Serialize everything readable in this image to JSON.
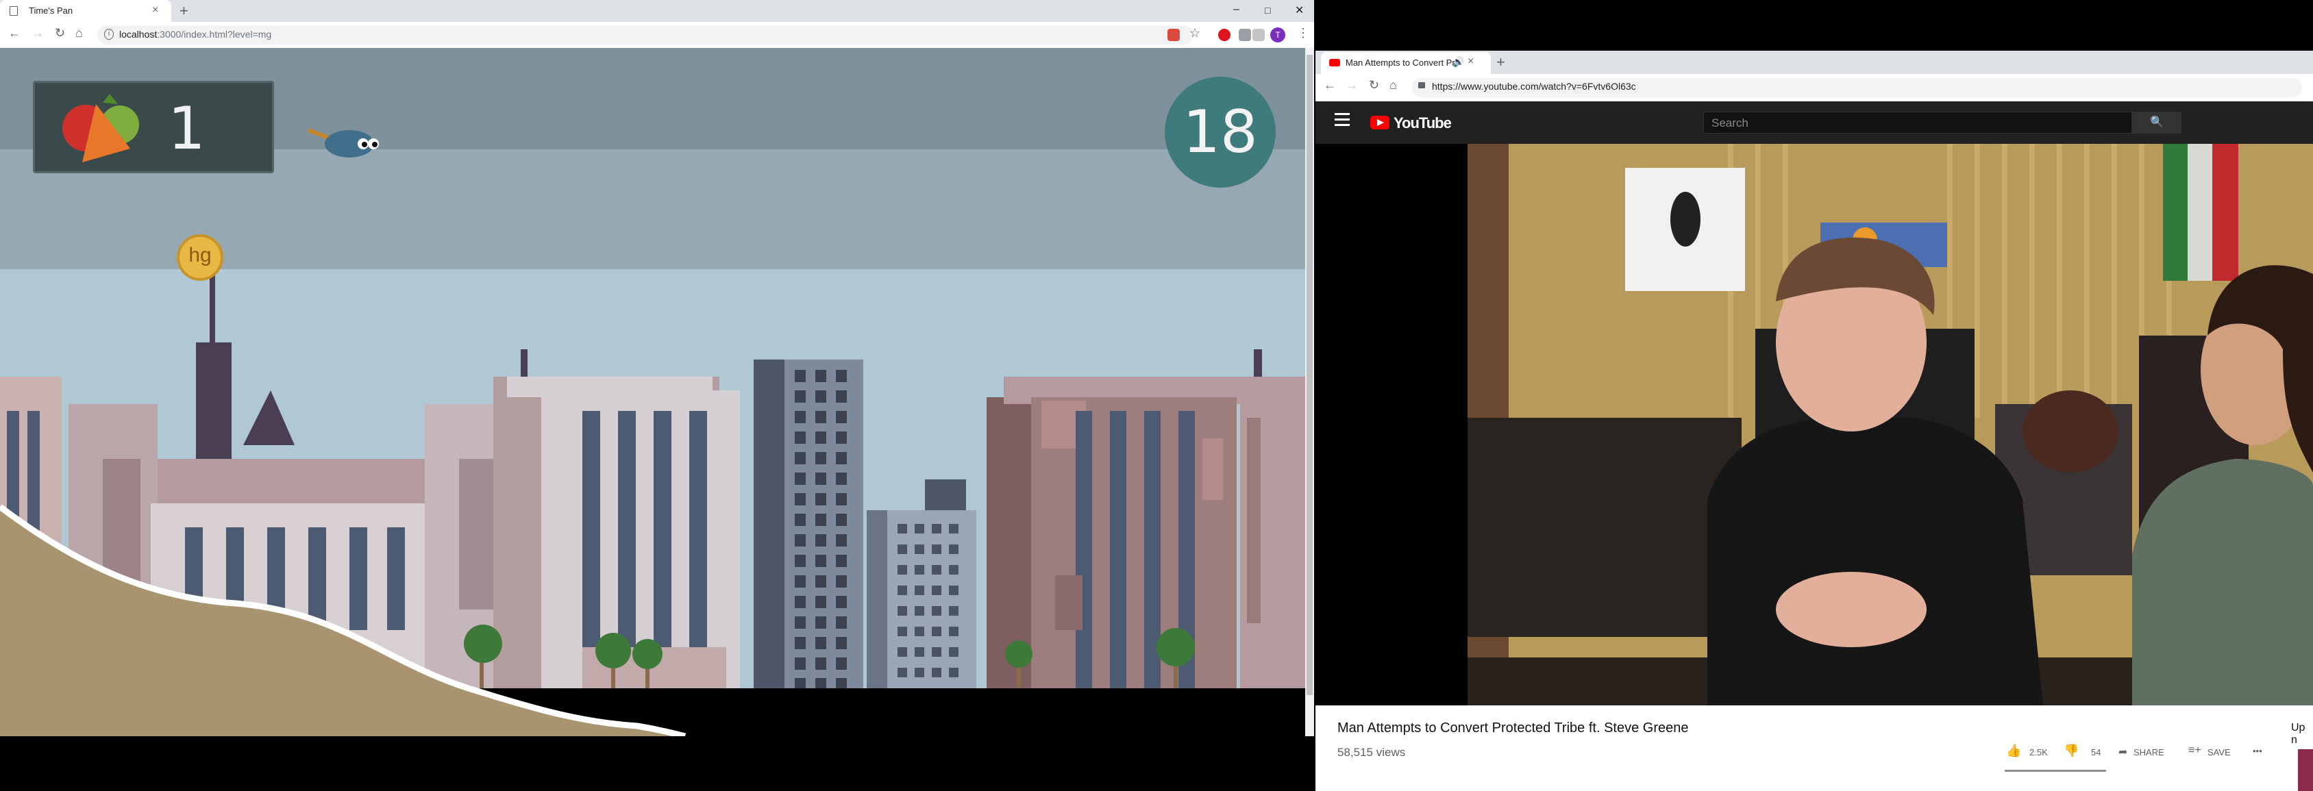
{
  "left_window": {
    "tab_title": "Time's Pan",
    "new_tab": "+",
    "tab_close": "×",
    "window_controls": {
      "minimize": "–",
      "maximize": "□",
      "close": "✕"
    },
    "url_host": "localhost",
    "url_path": ":3000/index.html?level=mg",
    "avatar_letter": "T",
    "game": {
      "score": "1",
      "timer": "18",
      "coin_label": "hg"
    }
  },
  "right_window": {
    "tab_title": "Man Attempts to Convert Pr",
    "new_tab": "+",
    "tab_close": "×",
    "url": "https://www.youtube.com/watch?v=6Fvtv6Ol63c",
    "youtube": {
      "logo_text": "YouTube",
      "search_placeholder": "Search",
      "video_title": "Man Attempts to Convert Protected Tribe ft. Steve Greene",
      "views": "58,515 views",
      "likes": "2.5K",
      "dislikes": "54",
      "share_label": "SHARE",
      "save_label": "SAVE",
      "more_label": "•••",
      "up_next": "Up n"
    }
  },
  "colors": {
    "sky_top": "#7f929b",
    "sky_bottom": "#b0c7d4",
    "ground": "#a99470",
    "timer_bg": "#3f7a7c",
    "youtube_red": "#ff0000",
    "youtube_header": "#212121"
  }
}
